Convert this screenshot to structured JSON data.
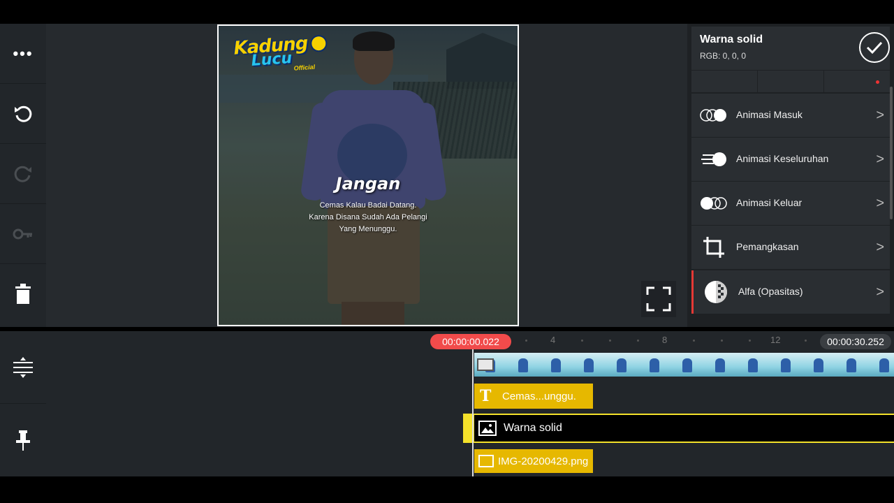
{
  "left_toolbar": {
    "items": [
      {
        "name": "more-icon",
        "glyph": "•••",
        "enabled": true
      },
      {
        "name": "undo-icon",
        "glyph": "↺",
        "enabled": true
      },
      {
        "name": "redo-icon",
        "glyph": "↻",
        "enabled": false
      },
      {
        "name": "key-icon",
        "glyph": "⚷",
        "enabled": false
      },
      {
        "name": "trash-icon",
        "glyph": "🗑",
        "enabled": true
      }
    ],
    "bottom_items": [
      {
        "name": "split-icon",
        "glyph": "⇞",
        "enabled": true
      },
      {
        "name": "pin-icon",
        "glyph": "📌",
        "enabled": true
      }
    ]
  },
  "preview": {
    "logo_line1": "Kadung",
    "logo_line2": "Lucu",
    "logo_line3": "Official",
    "caption_title": "Jangan",
    "caption_line1": "Cemas Kalau Badai Datang.",
    "caption_line2": "Karena Disana Sudah Ada Pelangi",
    "caption_line3": "Yang Menunggu."
  },
  "panel": {
    "title": "Warna solid",
    "subtitle": "RGB: 0, 0, 0",
    "items": [
      {
        "label": "Animasi Masuk",
        "icon": "animation-in-icon"
      },
      {
        "label": "Animasi Keseluruhan",
        "icon": "animation-overall-icon"
      },
      {
        "label": "Animasi Keluar",
        "icon": "animation-out-icon"
      },
      {
        "label": "Pemangkasan",
        "icon": "crop-icon"
      },
      {
        "label": "Alfa (Opasitas)",
        "icon": "opacity-icon"
      }
    ]
  },
  "timeline": {
    "current_time": "00:00:00.022",
    "end_time": "00:00:30.252",
    "ticks": [
      "4",
      "8",
      "12"
    ],
    "tracks": {
      "text_label": "Cemas...unggu.",
      "solid_label": "Warna solid",
      "png_label": "IMG-20200429.png"
    }
  },
  "colors": {
    "accent_red": "#f14b4b",
    "track_yellow": "#e6b800",
    "selected_border": "#f4e12a"
  }
}
